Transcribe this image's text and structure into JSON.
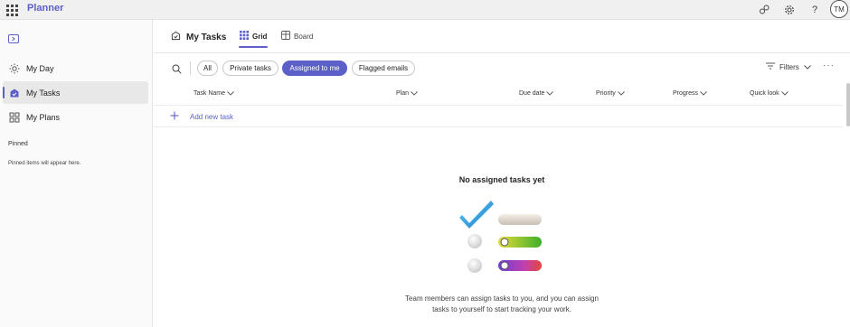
{
  "topbar": {
    "app_name": "Planner",
    "avatar_initials": "TM",
    "icons": [
      "waffle-icon",
      "share-icon",
      "settings-icon",
      "help-icon"
    ]
  },
  "sidebar": {
    "items": [
      {
        "label": "My Day",
        "icon": "sun-icon"
      },
      {
        "label": "My Tasks",
        "icon": "tasks-icon",
        "active": true
      },
      {
        "label": "My Plans",
        "icon": "grid-icon"
      }
    ],
    "pinned_title": "Pinned",
    "pinned_empty": "Pinned items will appear here."
  },
  "header": {
    "title": "My Tasks",
    "tabs": [
      {
        "label": "Grid",
        "active": true
      },
      {
        "label": "Board",
        "active": false
      }
    ]
  },
  "filters": {
    "pills": [
      {
        "label": "All",
        "active": false
      },
      {
        "label": "Private tasks",
        "active": false
      },
      {
        "label": "Assigned to me",
        "active": true
      },
      {
        "label": "Flagged emails",
        "active": false
      }
    ],
    "filters_label": "Filters"
  },
  "columns": [
    "Task Name",
    "Plan",
    "Due date",
    "Priority",
    "Progress",
    "Quick look"
  ],
  "add_task_label": "Add new task",
  "empty_state": {
    "title": "No assigned tasks yet",
    "line1": "Team members can assign tasks to you, and you can assign",
    "line2": "tasks to yourself to start tracking your work."
  },
  "colors": {
    "accent": "#5b5fc7",
    "sidebar_bg": "#fafafa",
    "topbar_bg": "#f0f0f0"
  }
}
